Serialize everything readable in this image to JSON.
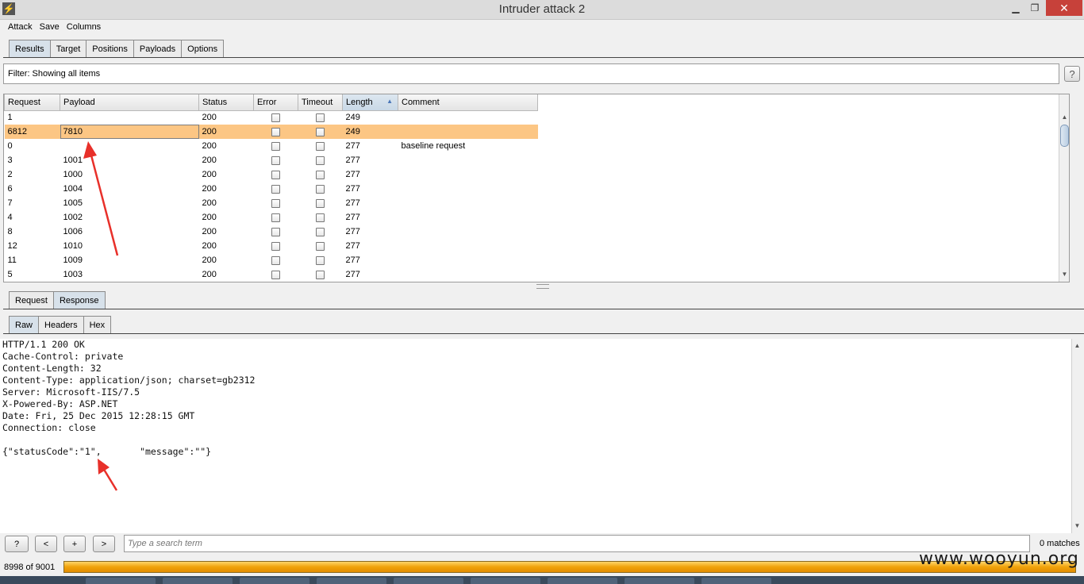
{
  "window": {
    "title": "Intruder attack 2"
  },
  "menu": [
    "Attack",
    "Save",
    "Columns"
  ],
  "main_tabs": [
    "Results",
    "Target",
    "Positions",
    "Payloads",
    "Options"
  ],
  "filter": {
    "text": "Filter: Showing all items",
    "help": "?"
  },
  "table": {
    "columns": [
      "Request",
      "Payload",
      "Status",
      "Error",
      "Timeout",
      "Length",
      "Comment"
    ],
    "sorted_column": "Length",
    "rows": [
      {
        "request": "1",
        "payload": "",
        "status": "200",
        "error": false,
        "timeout": false,
        "length": "249",
        "comment": ""
      },
      {
        "request": "6812",
        "payload": "7810",
        "status": "200",
        "error": false,
        "timeout": false,
        "length": "249",
        "comment": "",
        "selected": true
      },
      {
        "request": "0",
        "payload": "",
        "status": "200",
        "error": false,
        "timeout": false,
        "length": "277",
        "comment": "baseline request"
      },
      {
        "request": "3",
        "payload": "1001",
        "status": "200",
        "error": false,
        "timeout": false,
        "length": "277",
        "comment": ""
      },
      {
        "request": "2",
        "payload": "1000",
        "status": "200",
        "error": false,
        "timeout": false,
        "length": "277",
        "comment": ""
      },
      {
        "request": "6",
        "payload": "1004",
        "status": "200",
        "error": false,
        "timeout": false,
        "length": "277",
        "comment": ""
      },
      {
        "request": "7",
        "payload": "1005",
        "status": "200",
        "error": false,
        "timeout": false,
        "length": "277",
        "comment": ""
      },
      {
        "request": "4",
        "payload": "1002",
        "status": "200",
        "error": false,
        "timeout": false,
        "length": "277",
        "comment": ""
      },
      {
        "request": "8",
        "payload": "1006",
        "status": "200",
        "error": false,
        "timeout": false,
        "length": "277",
        "comment": ""
      },
      {
        "request": "12",
        "payload": "1010",
        "status": "200",
        "error": false,
        "timeout": false,
        "length": "277",
        "comment": ""
      },
      {
        "request": "11",
        "payload": "1009",
        "status": "200",
        "error": false,
        "timeout": false,
        "length": "277",
        "comment": ""
      },
      {
        "request": "5",
        "payload": "1003",
        "status": "200",
        "error": false,
        "timeout": false,
        "length": "277",
        "comment": ""
      }
    ]
  },
  "message_tabs": [
    "Request",
    "Response"
  ],
  "view_tabs": [
    "Raw",
    "Headers",
    "Hex"
  ],
  "response_raw": [
    "HTTP/1.1 200 OK",
    "Cache-Control: private",
    "Content-Length: 32",
    "Content-Type: application/json; charset=gb2312",
    "Server: Microsoft-IIS/7.5",
    "X-Powered-By: ASP.NET",
    "Date: Fri, 25 Dec 2015 12:28:15 GMT",
    "Connection: close",
    "",
    "{\"statusCode\":\"1\",       \"message\":\"\"}"
  ],
  "search": {
    "placeholder": "Type a search term",
    "matches": "0 matches",
    "buttons": [
      "?",
      "<",
      "+",
      ">"
    ]
  },
  "progress": {
    "text": "8998 of 9001",
    "completed": 8998,
    "total": 9001
  },
  "watermark": "www.wooyun.org",
  "colors": {
    "selected_row": "#fcc684",
    "progress": "#f0a20a",
    "active_tab": "#d7e1ea",
    "arrow": "#e8302a"
  }
}
